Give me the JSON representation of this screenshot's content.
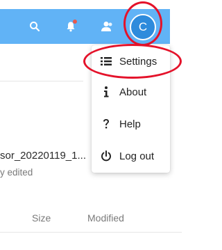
{
  "topbar": {
    "search_icon": "search-icon",
    "notification_icon": "bell-icon",
    "contacts_icon": "contacts-icon",
    "avatar_initial": "C"
  },
  "background": {
    "filename": "sor_20220119_1...",
    "edited": "y edited",
    "columns": [
      "Size",
      "Modified"
    ]
  },
  "menu": {
    "items": [
      {
        "label": "Settings",
        "icon": "settings-list-icon"
      },
      {
        "label": "About",
        "icon": "info-icon"
      },
      {
        "label": "Help",
        "icon": "help-icon"
      },
      {
        "label": "Log out",
        "icon": "power-icon"
      }
    ]
  },
  "colors": {
    "topbar": "#61b3f6",
    "avatar": "#2e8bdc",
    "annotation": "#e4122a",
    "notification_dot": "#e8594d"
  }
}
